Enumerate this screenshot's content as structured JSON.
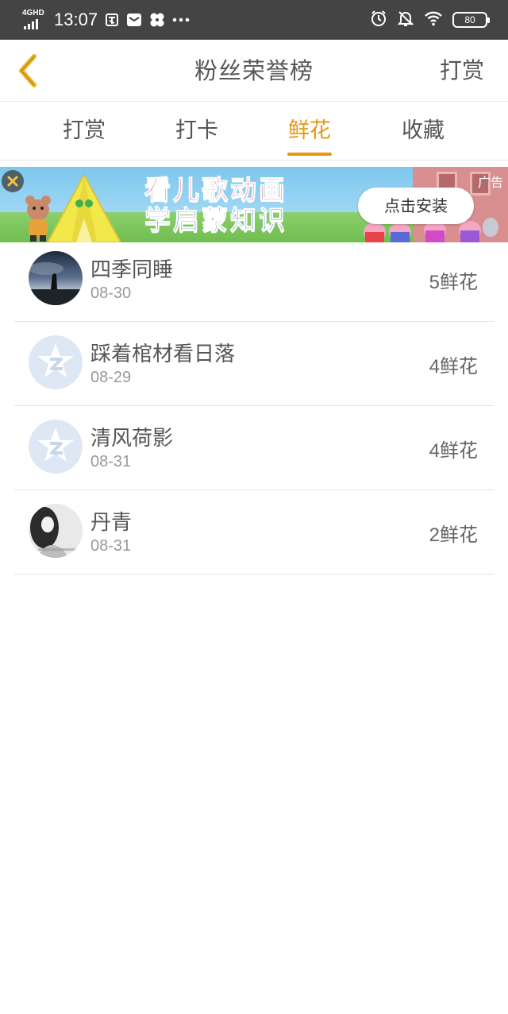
{
  "status_bar": {
    "network": "4GHD",
    "time": "13:07",
    "battery": "80"
  },
  "nav": {
    "title": "粉丝荣誉榜",
    "action": "打赏"
  },
  "tabs": [
    {
      "label": "打赏"
    },
    {
      "label": "打卡"
    },
    {
      "label": "鲜花"
    },
    {
      "label": "收藏"
    }
  ],
  "active_tab": "鲜花",
  "ad": {
    "line1": "看儿歌动画",
    "line2": "学启蒙知识",
    "button": "点击安装",
    "tag": "广告"
  },
  "rows": [
    {
      "name": "四季同睡",
      "date": "08-30",
      "count": "5",
      "unit": "鲜花",
      "avatar": "night-photo-avatar"
    },
    {
      "name": "踩着棺材看日落",
      "date": "08-29",
      "count": "4",
      "unit": "鲜花",
      "avatar": "default-qq-avatar"
    },
    {
      "name": "清风荷影",
      "date": "08-31",
      "count": "4",
      "unit": "鲜花",
      "avatar": "default-qq-avatar"
    },
    {
      "name": "丹青",
      "date": "08-31",
      "count": "2",
      "unit": "鲜花",
      "avatar": "bw-portrait-avatar"
    }
  ],
  "colors": {
    "accent": "#e6980f",
    "back_arrow": "#f0b429",
    "status_bar": "#444444"
  }
}
